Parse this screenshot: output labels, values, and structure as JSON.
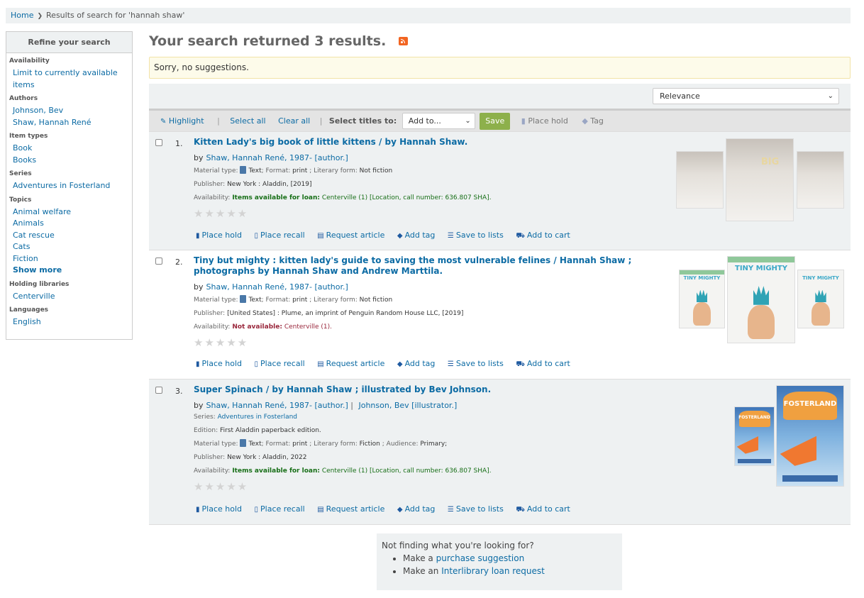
{
  "breadcrumb": {
    "home": "Home",
    "current": "Results of search for 'hannah shaw'"
  },
  "facets": {
    "title": "Refine your search",
    "groups": [
      {
        "label": "Availability",
        "items": [
          "Limit to currently available items"
        ]
      },
      {
        "label": "Authors",
        "items": [
          "Johnson, Bev",
          "Shaw, Hannah René"
        ]
      },
      {
        "label": "Item types",
        "items": [
          "Book",
          "Books"
        ]
      },
      {
        "label": "Series",
        "items": [
          "Adventures in Fosterland"
        ]
      },
      {
        "label": "Topics",
        "items": [
          "Animal welfare",
          "Animals",
          "Cat rescue",
          "Cats",
          "Fiction"
        ],
        "more": "Show more"
      },
      {
        "label": "Holding libraries",
        "items": [
          "Centerville"
        ]
      },
      {
        "label": "Languages",
        "items": [
          "English"
        ]
      }
    ]
  },
  "main": {
    "title": "Your search returned 3 results.",
    "suggestion": "Sorry, no suggestions.",
    "sort": {
      "selected": "Relevance"
    },
    "toolbar": {
      "highlight": "Highlight",
      "select_all": "Select all",
      "clear_all": "Clear all",
      "select_titles_to": "Select titles to:",
      "add_to": "Add to...",
      "save": "Save",
      "place_hold": "Place hold",
      "tag": "Tag"
    },
    "labels": {
      "by": "by",
      "material_type": "Material type:",
      "format": "Format:",
      "literary_form": "Literary form:",
      "audience": "Audience:",
      "publisher": "Publisher:",
      "availability": "Availability:",
      "series": "Series:",
      "edition": "Edition:",
      "stars": "★★★★★"
    },
    "actions": [
      "Place hold",
      "Place recall",
      "Request article",
      "Add tag",
      "Save to lists",
      "Add to cart"
    ],
    "results": [
      {
        "num": "1.",
        "title": "Kitten Lady's big book of little kittens / by Hannah Shaw.",
        "authors": [
          "Shaw, Hannah René, 1987- [author.]"
        ],
        "material": "Text",
        "format": "print",
        "literary_form": "Not fiction",
        "publisher": "New York : Aladdin, [2019]",
        "availability_status": "Items available for loan:",
        "availability_detail": "Centerville (1) [Location, call number: 636.807 SHA].",
        "available": true,
        "cover_text": "BIG BOOK Little KITTENS"
      },
      {
        "num": "2.",
        "title": "Tiny but mighty : kitten lady's guide to saving the most vulnerable felines / Hannah Shaw ; photographs by Hannah Shaw and Andrew Marttila.",
        "authors": [
          "Shaw, Hannah René, 1987- [author.]"
        ],
        "material": "Text",
        "format": "print",
        "literary_form": "Not fiction",
        "publisher": "[United States] : Plume, an imprint of Penguin Random House LLC, [2019]",
        "availability_status": "Not available:",
        "availability_detail": "Centerville (1).",
        "available": false,
        "cover_text": "TINY but MIGHTY"
      },
      {
        "num": "3.",
        "title": "Super Spinach / by Hannah Shaw ; illustrated by Bev Johnson.",
        "authors": [
          "Shaw, Hannah René, 1987- [author.]",
          "Johnson, Bev [illustrator.]"
        ],
        "series": "Adventures in Fosterland",
        "edition": "First Aladdin paperback edition.",
        "material": "Text",
        "format": "print",
        "literary_form": "Fiction",
        "audience": "Primary;",
        "publisher": "New York : Aladdin, 2022",
        "availability_status": "Items available for loan:",
        "availability_detail": "Centerville (1) [Location, call number: 636.807 SHA].",
        "available": true,
        "cover_text": "Adventures in FOSTERLAND"
      }
    ]
  },
  "not_finding": {
    "heading": "Not finding what you're looking for?",
    "items": [
      {
        "prefix": "Make a ",
        "link": "purchase suggestion"
      },
      {
        "prefix": "Make an ",
        "link": "Interlibrary loan request"
      }
    ]
  },
  "colors": {
    "link": "#0c6ba4",
    "save_button": "#8db04b",
    "available": "#166e16",
    "not_available": "#99263b",
    "rss": "#f26522"
  }
}
